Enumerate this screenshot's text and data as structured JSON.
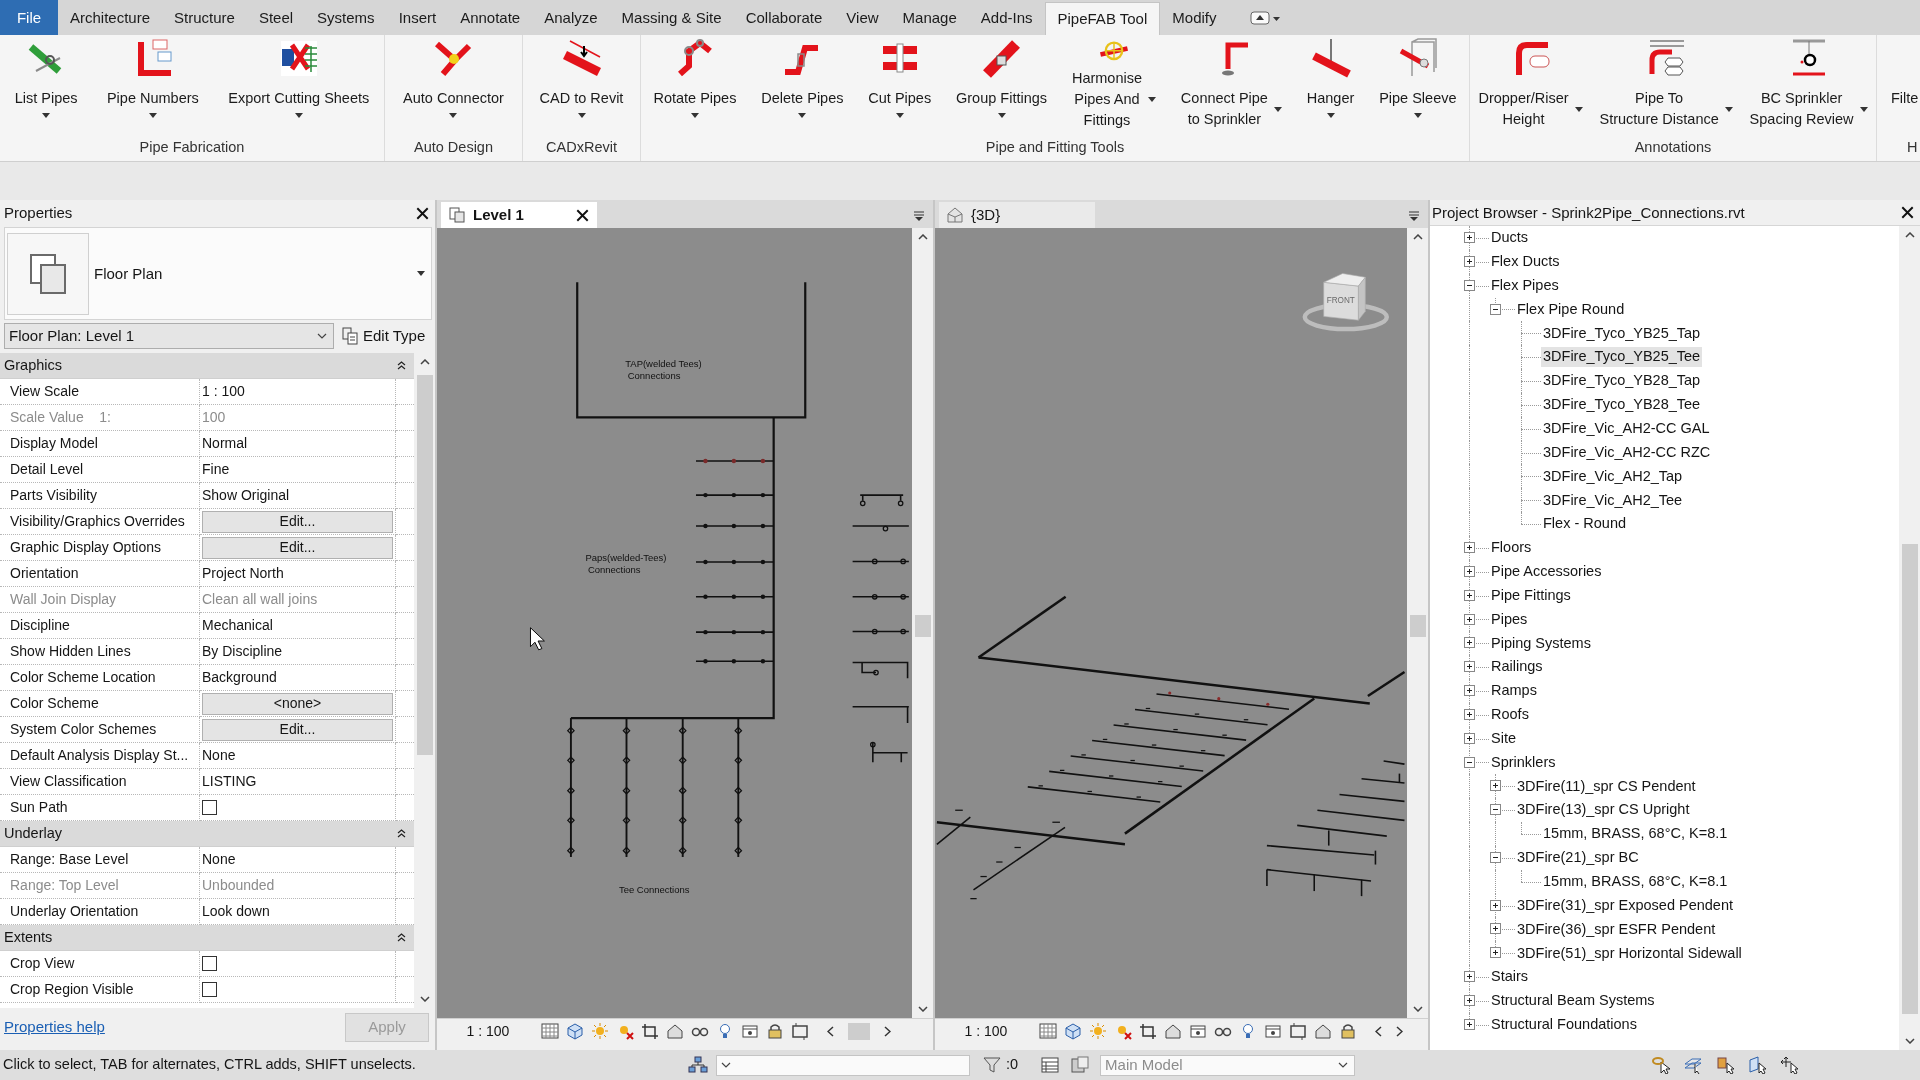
{
  "ribbon": {
    "tabs": [
      {
        "label": "File",
        "kind": "file",
        "selected": false
      },
      {
        "label": "Architecture",
        "kind": "tab",
        "selected": false
      },
      {
        "label": "Structure",
        "kind": "tab",
        "selected": false
      },
      {
        "label": "Steel",
        "kind": "tab",
        "selected": false
      },
      {
        "label": "Systems",
        "kind": "tab",
        "selected": false
      },
      {
        "label": "Insert",
        "kind": "tab",
        "selected": false
      },
      {
        "label": "Annotate",
        "kind": "tab",
        "selected": false
      },
      {
        "label": "Analyze",
        "kind": "tab",
        "selected": false
      },
      {
        "label": "Massing & Site",
        "kind": "tab",
        "selected": false
      },
      {
        "label": "Collaborate",
        "kind": "tab",
        "selected": false
      },
      {
        "label": "View",
        "kind": "tab",
        "selected": false
      },
      {
        "label": "Manage",
        "kind": "tab",
        "selected": false
      },
      {
        "label": "Add-Ins",
        "kind": "tab",
        "selected": false
      },
      {
        "label": "PipeFAB Tool",
        "kind": "tab",
        "selected": true
      },
      {
        "label": "Modify",
        "kind": "tab",
        "selected": false
      }
    ],
    "panels": [
      {
        "title": "Pipe Fabrication",
        "tools": [
          {
            "lines": [
              "List Pipes"
            ],
            "dropdown": true
          },
          {
            "lines": [
              "Pipe Numbers"
            ],
            "dropdown": true
          },
          {
            "lines": [
              "Export Cutting Sheets"
            ],
            "dropdown": true
          }
        ]
      },
      {
        "title": "Auto Design",
        "tools": [
          {
            "lines": [
              "Auto Connector"
            ],
            "dropdown": true
          }
        ]
      },
      {
        "title": "CADxRevit",
        "tools": [
          {
            "lines": [
              "CAD to Revit"
            ],
            "dropdown": true
          }
        ]
      },
      {
        "title": "Pipe and Fitting Tools",
        "tools": [
          {
            "lines": [
              "Rotate Pipes"
            ],
            "dropdown": true
          },
          {
            "lines": [
              "Delete Pipes"
            ],
            "dropdown": true
          },
          {
            "lines": [
              "Cut Pipes"
            ],
            "dropdown": true
          },
          {
            "lines": [
              "Group Fittings"
            ],
            "dropdown": true
          },
          {
            "lines": [
              "Harmonise",
              "Pipes And",
              "Fittings"
            ],
            "dropdown": true
          },
          {
            "lines": [
              "Connect Pipe",
              "to Sprinkler"
            ],
            "dropdown": true
          },
          {
            "lines": [
              "Hanger"
            ],
            "dropdown": true
          },
          {
            "lines": [
              "Pipe Sleeve"
            ],
            "dropdown": true
          }
        ]
      },
      {
        "title": "Annotations",
        "tools": [
          {
            "lines": [
              "Dropper/Riser",
              "Height"
            ],
            "dropdown": true
          },
          {
            "lines": [
              "Pipe To",
              "Structure Distance"
            ],
            "dropdown": true
          },
          {
            "lines": [
              "BC Sprinkler",
              "Spacing Review"
            ],
            "dropdown": true
          }
        ]
      },
      {
        "title": "H",
        "tools": [
          {
            "lines": [
              "Filte"
            ]
          }
        ]
      }
    ]
  },
  "properties": {
    "title": "Properties",
    "type_name": "Floor Plan",
    "instance": "Floor Plan: Level 1",
    "edit_type": "Edit Type",
    "sections": [
      {
        "title": "Graphics",
        "expanded": true,
        "rows": [
          {
            "name": "View Scale",
            "kind": "text",
            "value": "1 : 100",
            "disabled": false
          },
          {
            "name": "Scale Value    1:",
            "kind": "text",
            "value": "100",
            "disabled": true
          },
          {
            "name": "Display Model",
            "kind": "text",
            "value": "Normal",
            "disabled": false
          },
          {
            "name": "Detail Level",
            "kind": "text",
            "value": "Fine",
            "disabled": false
          },
          {
            "name": "Parts Visibility",
            "kind": "text",
            "value": "Show Original",
            "disabled": false
          },
          {
            "name": "Visibility/Graphics Overrides",
            "kind": "button",
            "value": "Edit...",
            "disabled": false
          },
          {
            "name": "Graphic Display Options",
            "kind": "button",
            "value": "Edit...",
            "disabled": false
          },
          {
            "name": "Orientation",
            "kind": "text",
            "value": "Project North",
            "disabled": false
          },
          {
            "name": "Wall Join Display",
            "kind": "text",
            "value": "Clean all wall joins",
            "disabled": true
          },
          {
            "name": "Discipline",
            "kind": "text",
            "value": "Mechanical",
            "disabled": false
          },
          {
            "name": "Show Hidden Lines",
            "kind": "text",
            "value": "By Discipline",
            "disabled": false
          },
          {
            "name": "Color Scheme Location",
            "kind": "text",
            "value": "Background",
            "disabled": false
          },
          {
            "name": "Color Scheme",
            "kind": "button",
            "value": "<none>",
            "disabled": false
          },
          {
            "name": "System Color Schemes",
            "kind": "button",
            "value": "Edit...",
            "disabled": false
          },
          {
            "name": "Default Analysis Display St...",
            "kind": "text",
            "value": "None",
            "disabled": false
          },
          {
            "name": "View Classification",
            "kind": "text",
            "value": "LISTING",
            "disabled": false
          },
          {
            "name": "Sun Path",
            "kind": "checkbox",
            "checked": false,
            "disabled": false
          }
        ]
      },
      {
        "title": "Underlay",
        "expanded": true,
        "rows": [
          {
            "name": "Range: Base Level",
            "kind": "text",
            "value": "None",
            "disabled": false
          },
          {
            "name": "Range: Top Level",
            "kind": "text",
            "value": "Unbounded",
            "disabled": true
          },
          {
            "name": "Underlay Orientation",
            "kind": "text",
            "value": "Look down",
            "disabled": false
          }
        ]
      },
      {
        "title": "Extents",
        "expanded": true,
        "rows": [
          {
            "name": "Crop View",
            "kind": "checkbox",
            "checked": false,
            "disabled": false
          },
          {
            "name": "Crop Region Visible",
            "kind": "checkbox",
            "checked": false,
            "disabled": false
          }
        ]
      }
    ],
    "help": "Properties help",
    "apply": {
      "label": "Apply",
      "disabled": true
    }
  },
  "views": [
    {
      "tab": "Level 1",
      "kind": "plan",
      "selected": true,
      "annotations": [
        {
          "lines": [
            "TAP(welded Tees)",
            "Connections"
          ]
        },
        {
          "lines": [
            "Paps(welded-Tees)",
            "Connections"
          ]
        },
        {
          "lines": [
            "Tee Connections"
          ]
        }
      ],
      "scale": "1 : 100"
    },
    {
      "tab": "{3D}",
      "kind": "isometric",
      "selected": false,
      "viewcube": "FRONT",
      "scale": "1 : 100"
    }
  ],
  "project_browser": {
    "title": "Project Browser - Sprink2Pipe_Connections.rvt",
    "items": [
      {
        "label": "Ducts",
        "expanded": false,
        "selected": false
      },
      {
        "label": "Flex Ducts",
        "expanded": false,
        "selected": false
      },
      {
        "label": "Flex Pipes",
        "expanded": true,
        "selected": false,
        "children": [
          {
            "label": "Flex Pipe Round",
            "expanded": true,
            "selected": false,
            "children": [
              {
                "label": "3DFire_Tyco_YB25_Tap",
                "selected": false
              },
              {
                "label": "3DFire_Tyco_YB25_Tee",
                "selected": true
              },
              {
                "label": "3DFire_Tyco_YB28_Tap",
                "selected": false
              },
              {
                "label": "3DFire_Tyco_YB28_Tee",
                "selected": false
              },
              {
                "label": "3DFire_Vic_AH2-CC GAL",
                "selected": false
              },
              {
                "label": "3DFire_Vic_AH2-CC RZC",
                "selected": false
              },
              {
                "label": "3DFire_Vic_AH2_Tap",
                "selected": false
              },
              {
                "label": "3DFire_Vic_AH2_Tee",
                "selected": false
              },
              {
                "label": "Flex - Round",
                "selected": false
              }
            ]
          }
        ]
      },
      {
        "label": "Floors",
        "expanded": false,
        "selected": false
      },
      {
        "label": "Pipe Accessories",
        "expanded": false,
        "selected": false
      },
      {
        "label": "Pipe Fittings",
        "expanded": false,
        "selected": false
      },
      {
        "label": "Pipes",
        "expanded": false,
        "selected": false
      },
      {
        "label": "Piping Systems",
        "expanded": false,
        "selected": false
      },
      {
        "label": "Railings",
        "expanded": false,
        "selected": false
      },
      {
        "label": "Ramps",
        "expanded": false,
        "selected": false
      },
      {
        "label": "Roofs",
        "expanded": false,
        "selected": false
      },
      {
        "label": "Site",
        "expanded": false,
        "selected": false
      },
      {
        "label": "Sprinklers",
        "expanded": true,
        "selected": false,
        "children": [
          {
            "label": "3DFire(11)_spr CS Pendent",
            "expanded": false,
            "selected": false
          },
          {
            "label": "3DFire(13)_spr CS Upright",
            "expanded": true,
            "selected": false,
            "children": [
              {
                "label": "15mm, BRASS, 68°C, K=8.1",
                "selected": false
              }
            ]
          },
          {
            "label": "3DFire(21)_spr BC",
            "expanded": true,
            "selected": false,
            "children": [
              {
                "label": "15mm, BRASS, 68°C, K=8.1",
                "selected": false
              }
            ]
          },
          {
            "label": "3DFire(31)_spr Exposed Pendent",
            "expanded": false,
            "selected": false
          },
          {
            "label": "3DFire(36)_spr ESFR Pendent",
            "expanded": false,
            "selected": false
          },
          {
            "label": "3DFire(51)_spr Horizontal Sidewall",
            "expanded": false,
            "selected": false
          }
        ]
      },
      {
        "label": "Stairs",
        "expanded": false,
        "selected": false
      },
      {
        "label": "Structural Beam Systems",
        "expanded": false,
        "selected": false
      },
      {
        "label": "Structural Foundations",
        "expanded": false,
        "selected": false
      }
    ]
  },
  "status_bar": {
    "message": "Click to select, TAB for alternates, CTRL adds, SHIFT unselects.",
    "selection_count": ":0",
    "model": {
      "value": "Main Model",
      "disabled": true
    }
  }
}
